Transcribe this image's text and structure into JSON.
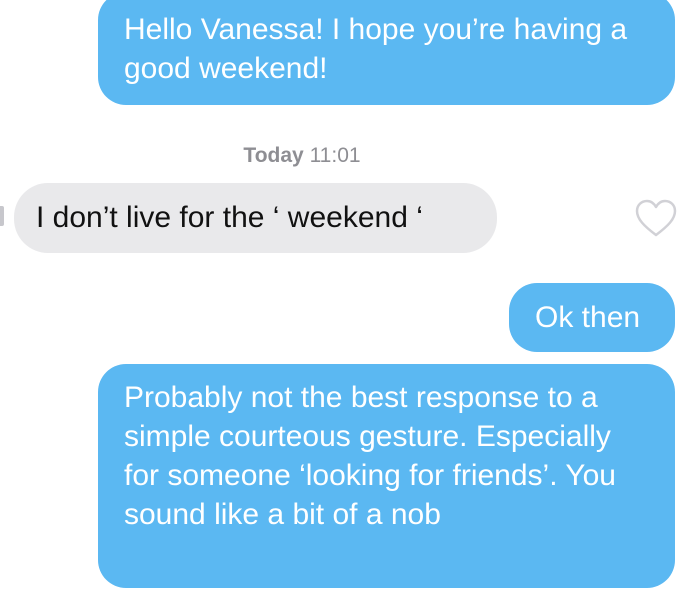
{
  "conversation": {
    "messages": [
      {
        "direction": "outgoing",
        "text": "Hello Vanessa! I hope you’re having a good weekend!"
      },
      {
        "direction": "incoming",
        "text": "I don’t live for the ‘ weekend ‘"
      },
      {
        "direction": "outgoing",
        "text": "Ok then"
      },
      {
        "direction": "outgoing",
        "text": "Probably not the best response to a simple courteous gesture. Especially for someone ‘looking for friends’. You sound like a bit of a nob"
      }
    ],
    "timestamp": {
      "day": "Today",
      "time": "11:01"
    }
  },
  "icons": {
    "like": "heart-outline-icon"
  },
  "colors": {
    "outgoing_bubble": "#5bb8f2",
    "incoming_bubble": "#e9e9eb",
    "timestamp_text": "#8e8e93",
    "heart_outline": "#d1d1d6"
  }
}
